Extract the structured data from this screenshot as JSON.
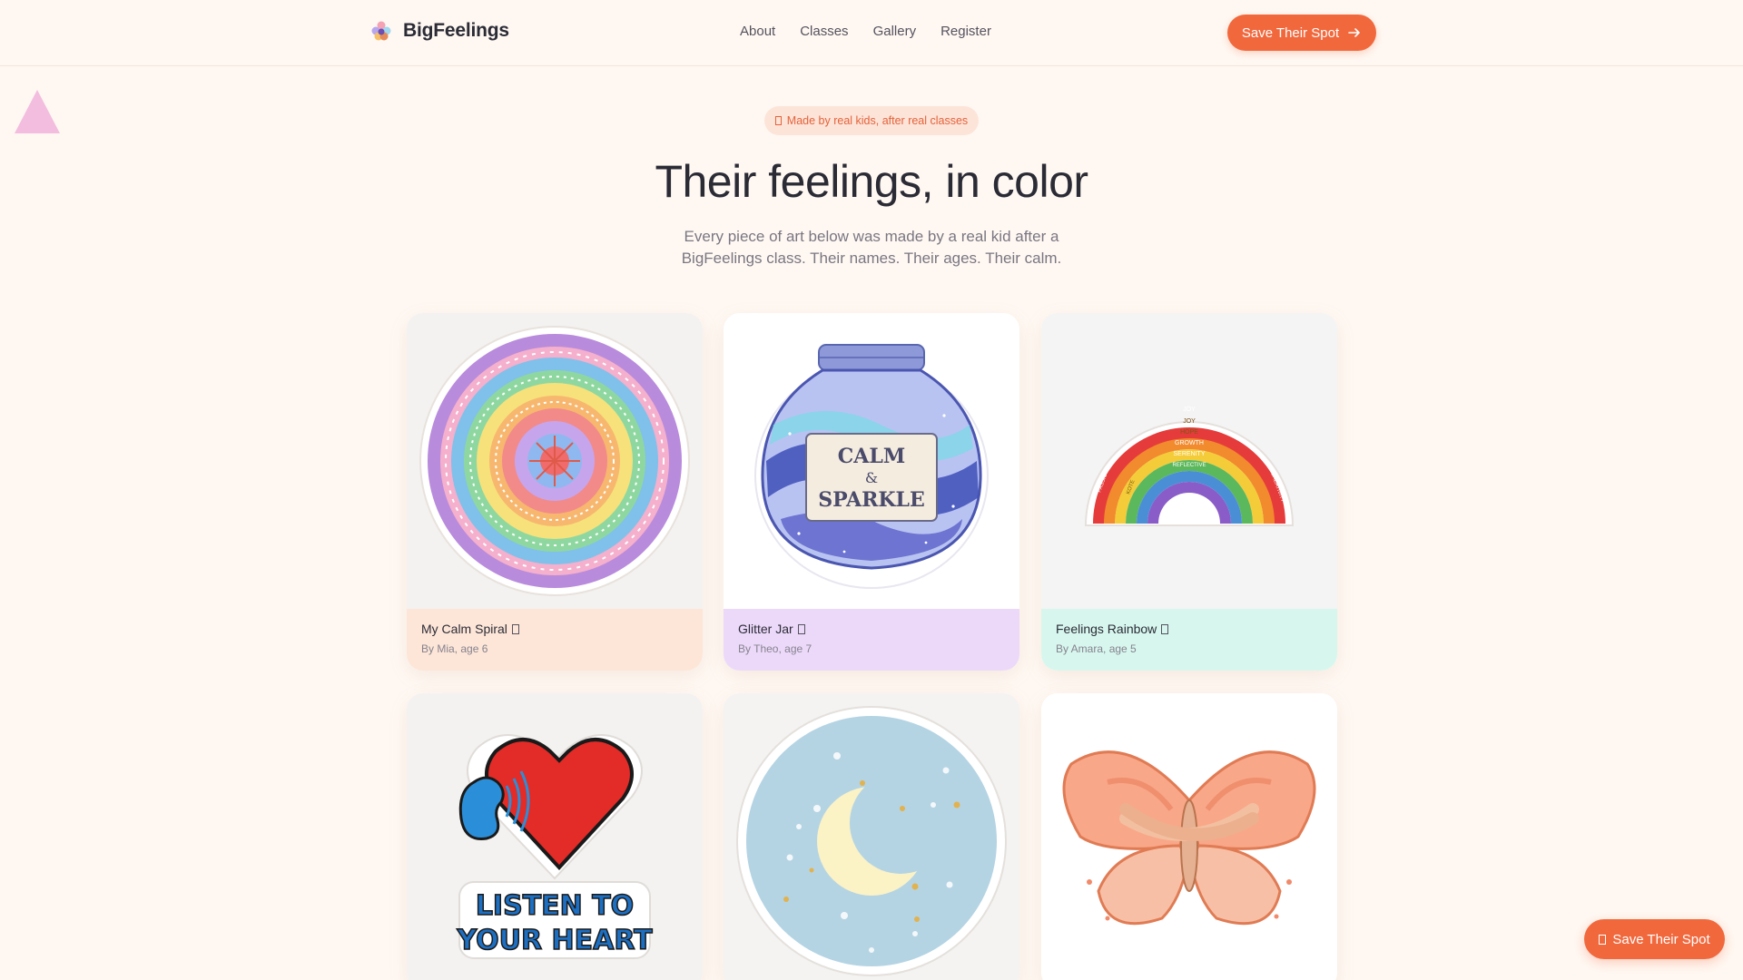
{
  "colors": {
    "accent": "#f1683d",
    "background": "#fff8f2",
    "pill_bg": "#fde4d9",
    "caption_peach": "#fde6d8",
    "caption_lavender": "#ecd9fa",
    "caption_mint": "#d7f7ee",
    "triangle": "#f1b6dc"
  },
  "header": {
    "brand": "BigFeelings",
    "logo_icon": "flower-logo-icon",
    "nav": [
      "About",
      "Classes",
      "Gallery",
      "Register"
    ],
    "cta_label": "Save Their Spot",
    "cta_icon": "arrow-right-icon"
  },
  "hero": {
    "pill_text": "Made by real kids, after real classes",
    "title": "Their feelings, in color",
    "subtitle_line1": "Every piece of art below was made by a real kid after a",
    "subtitle_line2": "BigFeelings class. Their names. Their ages. Their calm."
  },
  "gallery": [
    {
      "title": "My Calm Spiral",
      "byline": "By Mia, age 6",
      "art_icon": "rainbow-mandala-art",
      "caption_color": "#fde6d8"
    },
    {
      "title": "Glitter Jar",
      "byline": "By Theo, age 7",
      "art_icon": "calm-sparkle-jar-art",
      "art_text": [
        "CALM",
        "&",
        "SPARKLE"
      ],
      "caption_color": "#ecd9fa"
    },
    {
      "title": "Feelings Rainbow",
      "byline": "By Amara, age 5",
      "art_icon": "feelings-rainbow-art",
      "art_words": [
        "JOY",
        "JOY",
        "HOPE",
        "GROWTH",
        "SERENITY",
        "REFLECTIVE",
        "PASSION",
        "KOTE",
        "CREATIVITY"
      ],
      "caption_color": "#d7f7ee"
    },
    {
      "art_icon": "listen-to-your-heart-art",
      "art_text": [
        "LISTEN TO",
        "YOUR HEART"
      ]
    },
    {
      "art_icon": "moon-and-stars-art"
    },
    {
      "art_icon": "butterfly-hug-art"
    }
  ],
  "floating_cta": {
    "label": "Save Their Spot"
  }
}
